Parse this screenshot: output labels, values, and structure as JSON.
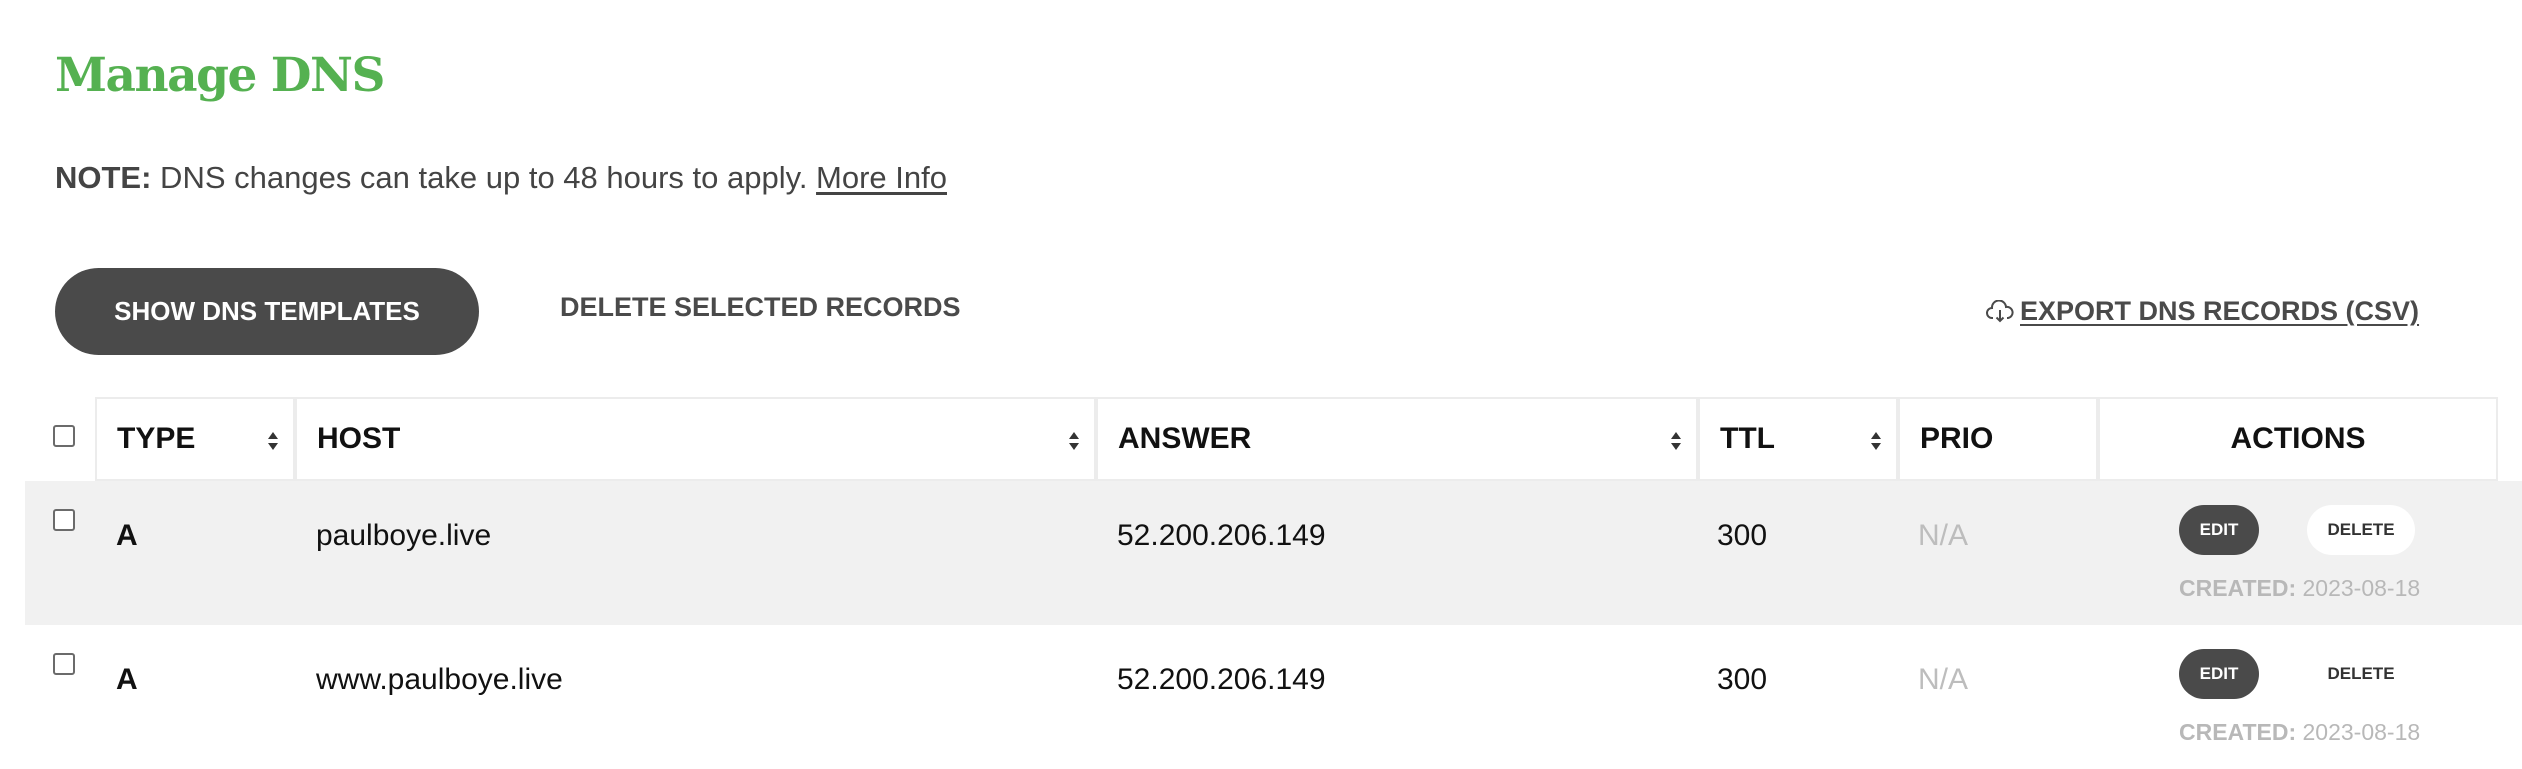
{
  "page": {
    "title": "Manage DNS",
    "note_label": "NOTE:",
    "note_text": " DNS changes can take up to 48 hours to apply. ",
    "note_link": "More Info"
  },
  "toolbar": {
    "show_templates_label": "SHOW DNS TEMPLATES",
    "delete_selected_label": "DELETE SELECTED RECORDS",
    "export_label": "EXPORT DNS RECORDS (CSV)",
    "export_icon": "cloud-download-icon"
  },
  "table": {
    "columns": [
      {
        "key": "type",
        "label": "TYPE",
        "sortable": true
      },
      {
        "key": "host",
        "label": "HOST",
        "sortable": true
      },
      {
        "key": "answer",
        "label": "ANSWER",
        "sortable": true
      },
      {
        "key": "ttl",
        "label": "TTL",
        "sortable": true
      },
      {
        "key": "prio",
        "label": "PRIO",
        "sortable": false
      },
      {
        "key": "actions",
        "label": "ACTIONS",
        "sortable": false
      }
    ],
    "rows": [
      {
        "type": "A",
        "host": "paulboye.live",
        "answer": "52.200.206.149",
        "ttl": "300",
        "prio": "N/A",
        "edit_label": "EDIT",
        "delete_label": "DELETE",
        "created_label": "CREATED:",
        "created_date": " 2023-08-18"
      },
      {
        "type": "A",
        "host": "www.paulboye.live",
        "answer": "52.200.206.149",
        "ttl": "300",
        "prio": "N/A",
        "edit_label": "EDIT",
        "delete_label": "DELETE",
        "created_label": "CREATED:",
        "created_date": " 2023-08-18"
      }
    ]
  },
  "colors": {
    "title_green": "#55b151",
    "button_dark": "#4a4a4a",
    "row_shade": "#f1f1f1",
    "muted_text": "#b8b8b8"
  }
}
